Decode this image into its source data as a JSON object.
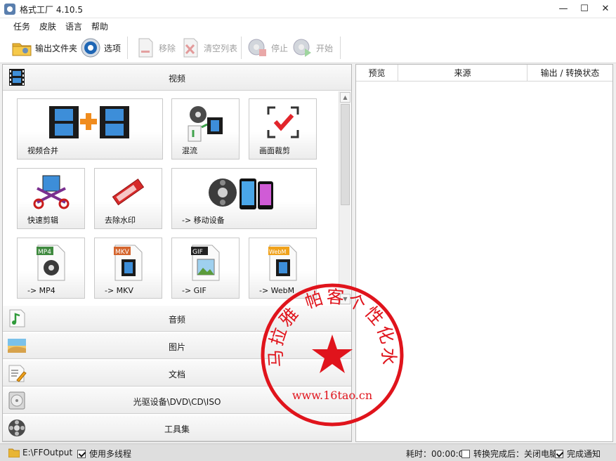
{
  "window": {
    "title": "格式工厂 4.10.5",
    "minimize_glyph": "—",
    "maximize_glyph": "☐",
    "close_glyph": "✕"
  },
  "menu": [
    "任务",
    "皮肤",
    "语言",
    "帮助"
  ],
  "toolbar": {
    "output_folder": "输出文件夹",
    "options": "选项",
    "remove": "移除",
    "clear_list": "清空列表",
    "stop": "停止",
    "start": "开始"
  },
  "categories": {
    "video": "视频",
    "audio": "音频",
    "image": "图片",
    "document": "文档",
    "optical": "光驱设备\\DVD\\CD\\ISO",
    "tools": "工具集"
  },
  "video_tiles": [
    {
      "label": "视频合并",
      "icon": "video-merge-icon"
    },
    {
      "label": "混流",
      "icon": "mux-icon"
    },
    {
      "label": "画面裁剪",
      "icon": "crop-icon"
    },
    {
      "label": "快速剪辑",
      "icon": "quick-cut-icon"
    },
    {
      "label": "去除水印",
      "icon": "remove-watermark-icon"
    },
    {
      "label": "-> 移动设备",
      "icon": "mobile-device-icon"
    },
    {
      "label": "-> MP4",
      "icon": "mp4-file-icon",
      "badge": "MP4"
    },
    {
      "label": "-> MKV",
      "icon": "mkv-file-icon",
      "badge": "MKV"
    },
    {
      "label": "-> GIF",
      "icon": "gif-file-icon",
      "badge": "GIF"
    },
    {
      "label": "-> WebM",
      "icon": "webm-file-icon",
      "badge": "WebM"
    }
  ],
  "task_columns": {
    "preview": "预览",
    "source": "来源",
    "status": "输出 / 转换状态"
  },
  "statusbar": {
    "output_path": "E:\\FFOutput",
    "multithread": "使用多线程",
    "multithread_checked": true,
    "elapsed": "耗时：00:00:00",
    "after_convert": "转换完成后：关闭电脑",
    "after_convert_checked": false,
    "notify": "完成通知",
    "notify_checked": true
  },
  "watermark": {
    "arc_text": "喜马拉雅 帕客个性化水印",
    "url": "www.16tao.cn",
    "color": "#e0141c"
  }
}
